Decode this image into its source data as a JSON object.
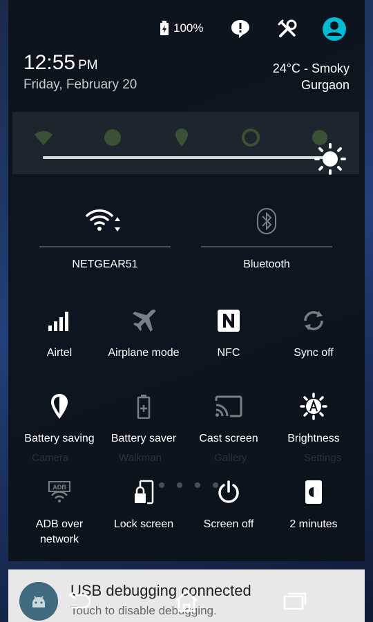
{
  "status": {
    "battery_level": "100%",
    "icons": [
      "battery-charging-icon",
      "message-alert-icon",
      "settings-tools-icon",
      "user-profile-icon"
    ]
  },
  "header": {
    "time": "12:55",
    "ampm": "PM",
    "date": "Friday, February 20",
    "weather_line1": "24°C - Smoky",
    "weather_line2": "Gurgaon"
  },
  "brightness": {
    "level": 1.0
  },
  "big_tiles": [
    {
      "label": "NETGEAR51",
      "icon": "wifi-icon",
      "state": "on"
    },
    {
      "label": "Bluetooth",
      "icon": "bluetooth-icon",
      "state": "off"
    }
  ],
  "tiles_row1": [
    {
      "label": "Airtel",
      "icon": "signal-icon",
      "state": "on"
    },
    {
      "label": "Airplane mode",
      "icon": "airplane-icon",
      "state": "off"
    },
    {
      "label": "NFC",
      "icon": "nfc-icon",
      "state": "on"
    },
    {
      "label": "Sync off",
      "icon": "sync-icon",
      "state": "off"
    }
  ],
  "tiles_row2": [
    {
      "label": "Battery saving",
      "icon": "location-icon",
      "state": "on"
    },
    {
      "label": "Battery saver",
      "icon": "battery-plus-icon",
      "state": "off"
    },
    {
      "label": "Cast screen",
      "icon": "cast-icon",
      "state": "off"
    },
    {
      "label": "Brightness",
      "icon": "brightness-auto-icon",
      "state": "on"
    }
  ],
  "tiles_row3": [
    {
      "label": "ADB over network",
      "label_line1": "ADB over",
      "label_line2": "network",
      "icon": "adb-icon",
      "state": "off"
    },
    {
      "label": "Lock screen",
      "icon": "lock-screen-icon",
      "state": "on"
    },
    {
      "label": "Screen off",
      "icon": "power-icon",
      "state": "on"
    },
    {
      "label": "2 minutes",
      "icon": "screen-timeout-icon",
      "state": "on"
    }
  ],
  "background_labels": [
    "Camera",
    "Walkman",
    "Gallery",
    "Settings"
  ],
  "notification": {
    "title": "USB debugging connected",
    "subtitle": "Touch to disable debugging."
  },
  "navbar": {
    "icons": [
      "back-icon",
      "home-icon",
      "recents-icon"
    ]
  },
  "colors": {
    "accent": "#00bcd4",
    "panel": "#0c121a"
  }
}
